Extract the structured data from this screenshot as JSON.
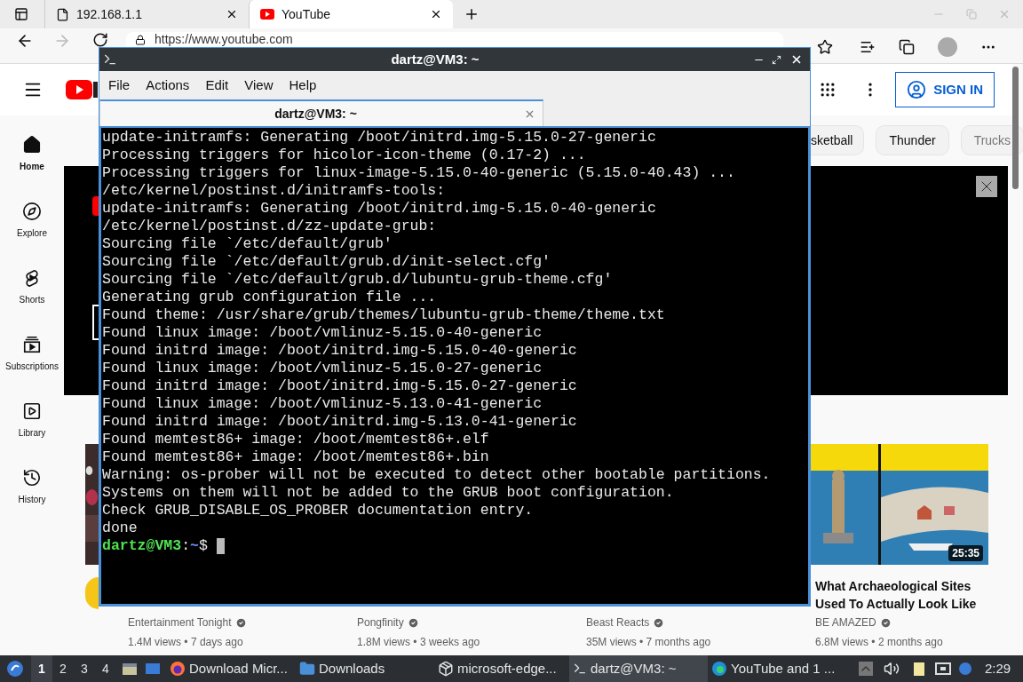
{
  "browser": {
    "tabs": [
      {
        "title": "192.168.1.1",
        "selected": false
      },
      {
        "title": "YouTube",
        "selected": true
      }
    ],
    "address": "https://www.youtube.com"
  },
  "youtube": {
    "sign_in": "SIGN IN",
    "sidebar": [
      {
        "label": "Home",
        "selected": true
      },
      {
        "label": "Explore",
        "selected": false
      },
      {
        "label": "Shorts",
        "selected": false
      },
      {
        "label": "Subscriptions",
        "selected": false
      },
      {
        "label": "Library",
        "selected": false
      },
      {
        "label": "History",
        "selected": false
      }
    ],
    "chips": [
      "sketball",
      "Thunder",
      "Trucks"
    ],
    "banner": {
      "button": true
    },
    "videos": [
      {
        "channel": "Entertainment Tonight",
        "verified": true,
        "meta": "1.4M views • 7 days ago",
        "avatar": true
      },
      {
        "channel": "Pongfinity",
        "verified": true,
        "meta": "1.8M views • 3 weeks ago",
        "avatar": false
      },
      {
        "channel": "Beast Reacts",
        "verified": true,
        "meta": "35M views • 7 months ago",
        "avatar": false
      },
      {
        "title": "What Archaeological Sites Used To Actually Look Like",
        "channel": "BE AMAZED",
        "verified": true,
        "meta": "6.8M views • 2 months ago",
        "duration": "25:35",
        "avatar": false
      }
    ]
  },
  "terminal": {
    "title": "dartz@VM3: ~",
    "menu": [
      "File",
      "Actions",
      "Edit",
      "View",
      "Help"
    ],
    "tab": "dartz@VM3: ~",
    "lines": [
      "update-initramfs: Generating /boot/initrd.img-5.15.0-27-generic",
      "Processing triggers for hicolor-icon-theme (0.17-2) ...",
      "Processing triggers for linux-image-5.15.0-40-generic (5.15.0-40.43) ...",
      "/etc/kernel/postinst.d/initramfs-tools:",
      "update-initramfs: Generating /boot/initrd.img-5.15.0-40-generic",
      "/etc/kernel/postinst.d/zz-update-grub:",
      "Sourcing file `/etc/default/grub'",
      "Sourcing file `/etc/default/grub.d/init-select.cfg'",
      "Sourcing file `/etc/default/grub.d/lubuntu-grub-theme.cfg'",
      "Generating grub configuration file ...",
      "Found theme: /usr/share/grub/themes/lubuntu-grub-theme/theme.txt",
      "Found linux image: /boot/vmlinuz-5.15.0-40-generic",
      "Found initrd image: /boot/initrd.img-5.15.0-40-generic",
      "Found linux image: /boot/vmlinuz-5.15.0-27-generic",
      "Found initrd image: /boot/initrd.img-5.15.0-27-generic",
      "Found linux image: /boot/vmlinuz-5.13.0-41-generic",
      "Found initrd image: /boot/initrd.img-5.13.0-41-generic",
      "Found memtest86+ image: /boot/memtest86+.elf",
      "Found memtest86+ image: /boot/memtest86+.bin",
      "Warning: os-prober will not be executed to detect other bootable partitions.",
      "Systems on them will not be added to the GRUB boot configuration.",
      "Check GRUB_DISABLE_OS_PROBER documentation entry.",
      "done"
    ],
    "prompt": {
      "user": "dartz@VM3",
      "sep": ":",
      "path": "~",
      "symbol": "$"
    }
  },
  "taskbar": {
    "workspaces": [
      {
        "label": "1",
        "selected": true
      },
      {
        "label": "2",
        "selected": false
      },
      {
        "label": "3",
        "selected": false
      },
      {
        "label": "4",
        "selected": false
      }
    ],
    "tasks": [
      {
        "label": "Download Micr...",
        "kind": "firefox",
        "selected": false
      },
      {
        "label": "Downloads",
        "kind": "folder",
        "selected": false
      },
      {
        "label": "microsoft-edge...",
        "kind": "package",
        "selected": false
      },
      {
        "label": "dartz@VM3: ~",
        "kind": "terminal",
        "selected": true
      },
      {
        "label": "YouTube and 1 ...",
        "kind": "edge",
        "selected": false
      }
    ],
    "clock": "2:29"
  }
}
